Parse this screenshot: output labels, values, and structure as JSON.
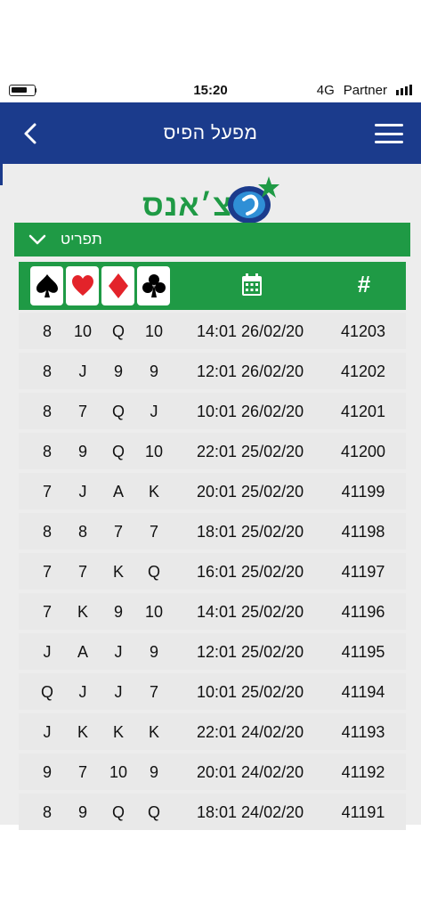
{
  "status_bar": {
    "time": "15:20",
    "network": "4G",
    "carrier": "Partner"
  },
  "nav": {
    "title": "מפעל הפיס"
  },
  "logo": {
    "text": "צ׳אנס"
  },
  "filter": {
    "label": "תפריט"
  },
  "colors": {
    "nav_blue": "#1b3b8c",
    "brand_green": "#1f9a45",
    "suit_red": "#e3232a"
  },
  "table": {
    "columns": [
      "spade-icon",
      "heart-icon",
      "diamond-icon",
      "club-icon",
      "calendar-icon",
      "#"
    ],
    "hash_label": "#",
    "rows": [
      {
        "spade": "8",
        "heart": "10",
        "diamond": "Q",
        "club": "10",
        "date": "14:01 26/02/20",
        "num": "41203"
      },
      {
        "spade": "8",
        "heart": "J",
        "diamond": "9",
        "club": "9",
        "date": "12:01 26/02/20",
        "num": "41202"
      },
      {
        "spade": "8",
        "heart": "7",
        "diamond": "Q",
        "club": "J",
        "date": "10:01 26/02/20",
        "num": "41201"
      },
      {
        "spade": "8",
        "heart": "9",
        "diamond": "Q",
        "club": "10",
        "date": "22:01 25/02/20",
        "num": "41200"
      },
      {
        "spade": "7",
        "heart": "J",
        "diamond": "A",
        "club": "K",
        "date": "20:01 25/02/20",
        "num": "41199"
      },
      {
        "spade": "8",
        "heart": "8",
        "diamond": "7",
        "club": "7",
        "date": "18:01 25/02/20",
        "num": "41198"
      },
      {
        "spade": "7",
        "heart": "7",
        "diamond": "K",
        "club": "Q",
        "date": "16:01 25/02/20",
        "num": "41197"
      },
      {
        "spade": "7",
        "heart": "K",
        "diamond": "9",
        "club": "10",
        "date": "14:01 25/02/20",
        "num": "41196"
      },
      {
        "spade": "J",
        "heart": "A",
        "diamond": "J",
        "club": "9",
        "date": "12:01 25/02/20",
        "num": "41195"
      },
      {
        "spade": "Q",
        "heart": "J",
        "diamond": "J",
        "club": "7",
        "date": "10:01 25/02/20",
        "num": "41194"
      },
      {
        "spade": "J",
        "heart": "K",
        "diamond": "K",
        "club": "K",
        "date": "22:01 24/02/20",
        "num": "41193"
      },
      {
        "spade": "9",
        "heart": "7",
        "diamond": "10",
        "club": "9",
        "date": "20:01 24/02/20",
        "num": "41192"
      },
      {
        "spade": "8",
        "heart": "9",
        "diamond": "Q",
        "club": "Q",
        "date": "18:01 24/02/20",
        "num": "41191"
      }
    ]
  }
}
